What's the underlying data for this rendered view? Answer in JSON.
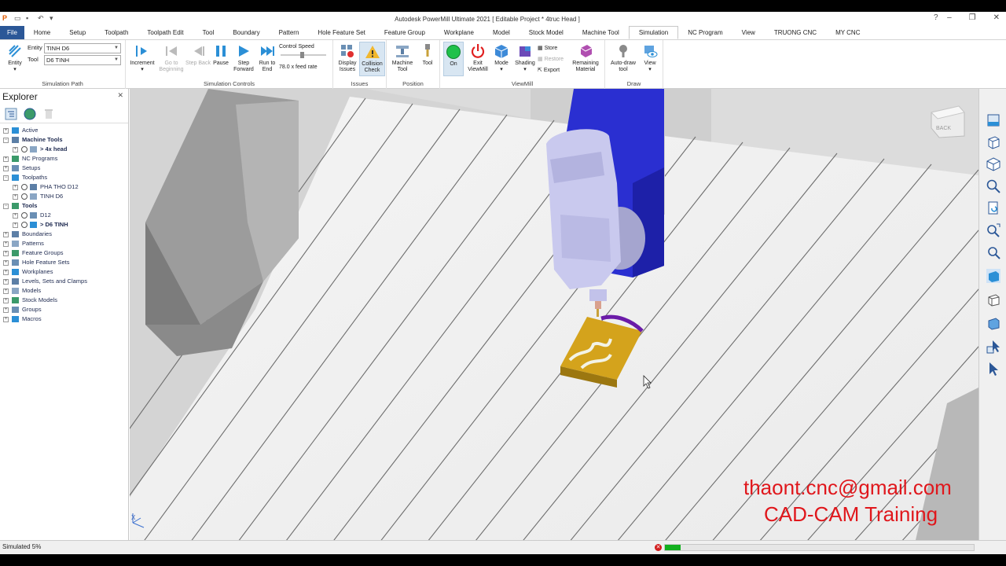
{
  "window": {
    "title": "Autodesk PowerMill Ultimate 2021   [ Editable Project * 4truc Head ]",
    "help_icon": "help-icon",
    "controls": [
      "minimize-icon",
      "restore-icon",
      "close-icon"
    ]
  },
  "tabs": [
    "File",
    "Home",
    "Setup",
    "Toolpath",
    "Toolpath Edit",
    "Tool",
    "Boundary",
    "Pattern",
    "Hole Feature Set",
    "Feature Group",
    "Workplane",
    "Model",
    "Stock Model",
    "Machine Tool",
    "Simulation",
    "NC Program",
    "View",
    "TRUONG CNC",
    "MY CNC"
  ],
  "active_tab": "Simulation",
  "ribbon": {
    "simulation_path": {
      "group_label": "Simulation Path",
      "entity_button": "Entity",
      "entity_label": "Entity",
      "entity_value": "TINH D6",
      "tool_label": "Tool",
      "tool_value": "D6 TINH"
    },
    "simulation_controls": {
      "group_label": "Simulation Controls",
      "increment": "Increment",
      "go_to_beginning": "Go to Beginning",
      "step_back": "Step Back",
      "pause": "Pause",
      "step_forward": "Step Forward",
      "run_to_end": "Run to End",
      "control_speed": "Control Speed",
      "feed_rate": "78.0 x feed rate"
    },
    "issues": {
      "group_label": "Issues",
      "display_issues": "Display Issues",
      "collision_check": "Collision Check"
    },
    "position": {
      "group_label": "Position",
      "machine_tool": "Machine Tool",
      "tool": "Tool"
    },
    "viewmill": {
      "group_label": "ViewMill",
      "on": "On",
      "exit_viewmill": "Exit ViewMill",
      "mode": "Mode",
      "shading": "Shading",
      "store": "Store",
      "restore": "Restore",
      "export": "Export",
      "remaining_material": "Remaining Material"
    },
    "draw": {
      "group_label": "Draw",
      "auto_draw_tool": "Auto-draw tool",
      "view": "View"
    }
  },
  "explorer": {
    "title": "Explorer",
    "items": [
      {
        "label": "Active",
        "level": 0,
        "bold": false
      },
      {
        "label": "Machine Tools",
        "level": 0,
        "bold": true
      },
      {
        "label": "> 4x head",
        "level": 1,
        "bold": true
      },
      {
        "label": "NC Programs",
        "level": 0,
        "bold": false
      },
      {
        "label": "Setups",
        "level": 0,
        "bold": false
      },
      {
        "label": "Toolpaths",
        "level": 0,
        "bold": false
      },
      {
        "label": "PHA THO D12",
        "level": 1,
        "bold": false
      },
      {
        "label": "TINH D6",
        "level": 1,
        "bold": false
      },
      {
        "label": "Tools",
        "level": 0,
        "bold": true
      },
      {
        "label": "D12",
        "level": 1,
        "bold": false
      },
      {
        "label": "> D6 TINH",
        "level": 1,
        "bold": true
      },
      {
        "label": "Boundaries",
        "level": 0,
        "bold": false
      },
      {
        "label": "Patterns",
        "level": 0,
        "bold": false
      },
      {
        "label": "Feature Groups",
        "level": 0,
        "bold": false
      },
      {
        "label": "Hole Feature Sets",
        "level": 0,
        "bold": false
      },
      {
        "label": "Workplanes",
        "level": 0,
        "bold": false
      },
      {
        "label": "Levels, Sets and Clamps",
        "level": 0,
        "bold": false
      },
      {
        "label": "Models",
        "level": 0,
        "bold": false
      },
      {
        "label": "Stock Models",
        "level": 0,
        "bold": false
      },
      {
        "label": "Groups",
        "level": 0,
        "bold": false
      },
      {
        "label": "Macros",
        "level": 0,
        "bold": false
      }
    ]
  },
  "viewport": {
    "viewcube_label": "BACK",
    "axis_label": "X",
    "watermark_email": "thaont.cnc@gmail.com",
    "watermark_training": "CAD-CAM Training"
  },
  "status": {
    "text": "Simulated 5%",
    "progress": 0.05
  },
  "colors": {
    "accent": "#2b5797",
    "brand_red": "#e0171c",
    "spindle_blue": "#2a2fd1",
    "stock_gold": "#d4a31c",
    "progress_green": "#13b01f"
  }
}
